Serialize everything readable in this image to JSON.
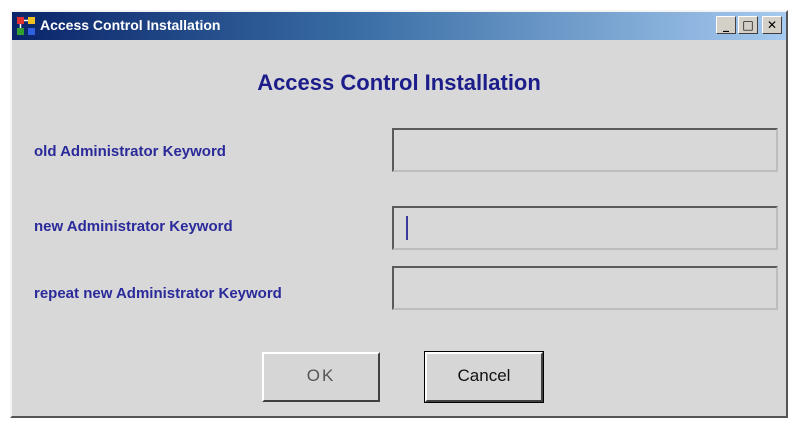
{
  "window": {
    "title": "Access Control Installation",
    "controls": {
      "minimize": "_",
      "maximize": "□",
      "close": "✕"
    }
  },
  "dialog": {
    "heading": "Access Control Installation",
    "fields": [
      {
        "label": "old Administrator Keyword",
        "value": ""
      },
      {
        "label": "new Administrator Keyword",
        "value": ""
      },
      {
        "label": "repeat new Administrator Keyword",
        "value": ""
      }
    ],
    "buttons": {
      "ok": "OK",
      "cancel": "Cancel"
    }
  },
  "colors": {
    "title_gradient_start": "#0a246a",
    "title_gradient_end": "#a6caf0",
    "label_text": "#2a2a9a",
    "heading_text": "#1c1c8a",
    "window_bg": "#d8d8d8"
  },
  "icons": {
    "app": "app-icon",
    "minimize": "minimize-icon",
    "maximize": "maximize-icon",
    "close": "close-icon"
  }
}
